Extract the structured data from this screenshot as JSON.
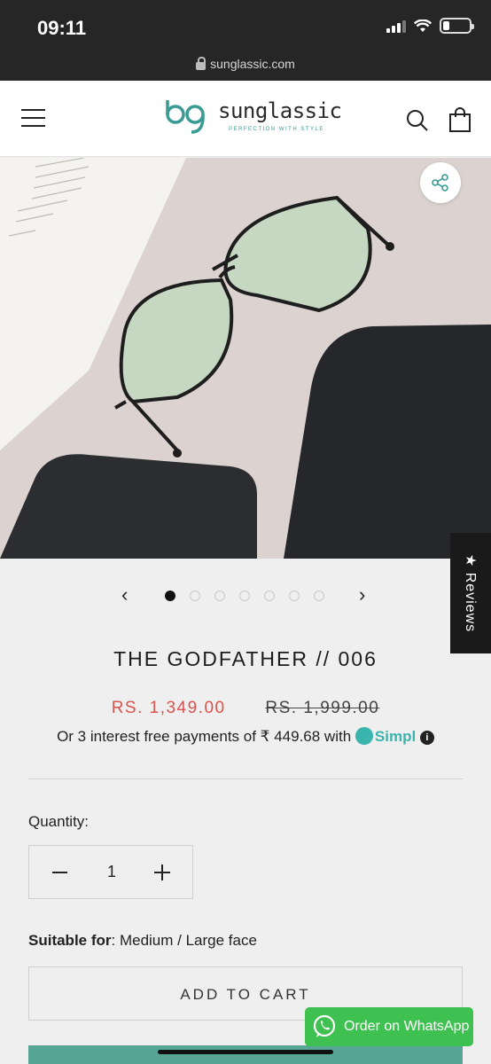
{
  "status_bar": {
    "time": "09:11"
  },
  "browser": {
    "url": "sunglassic.com"
  },
  "header": {
    "brand": "sunglassic",
    "tagline": "PERFECTION WITH STYLE",
    "icons": {
      "menu": "menu-icon",
      "search": "search-icon",
      "cart": "cart-icon"
    }
  },
  "product": {
    "title": "THE GODFATHER // 006",
    "sale_price": "RS. 1,349.00",
    "original_price": "RS. 1,999.00",
    "emi_text": "Or 3 interest free payments of ₹ 449.68 with",
    "emi_provider": "Simpl",
    "image_count": 7,
    "active_image": 1
  },
  "quantity": {
    "label": "Quantity:",
    "value": "1"
  },
  "suitable": {
    "label": "Suitable for",
    "value": ": Medium / Large face"
  },
  "actions": {
    "add_to_cart": "ADD TO CART",
    "whatsapp": "Order on WhatsApp"
  },
  "reviews_tab": "★ Reviews",
  "colors": {
    "sale": "#d9534f",
    "brand_teal": "#3a9a94",
    "whatsapp": "#3fc152",
    "simpl": "#3ab5ad"
  }
}
